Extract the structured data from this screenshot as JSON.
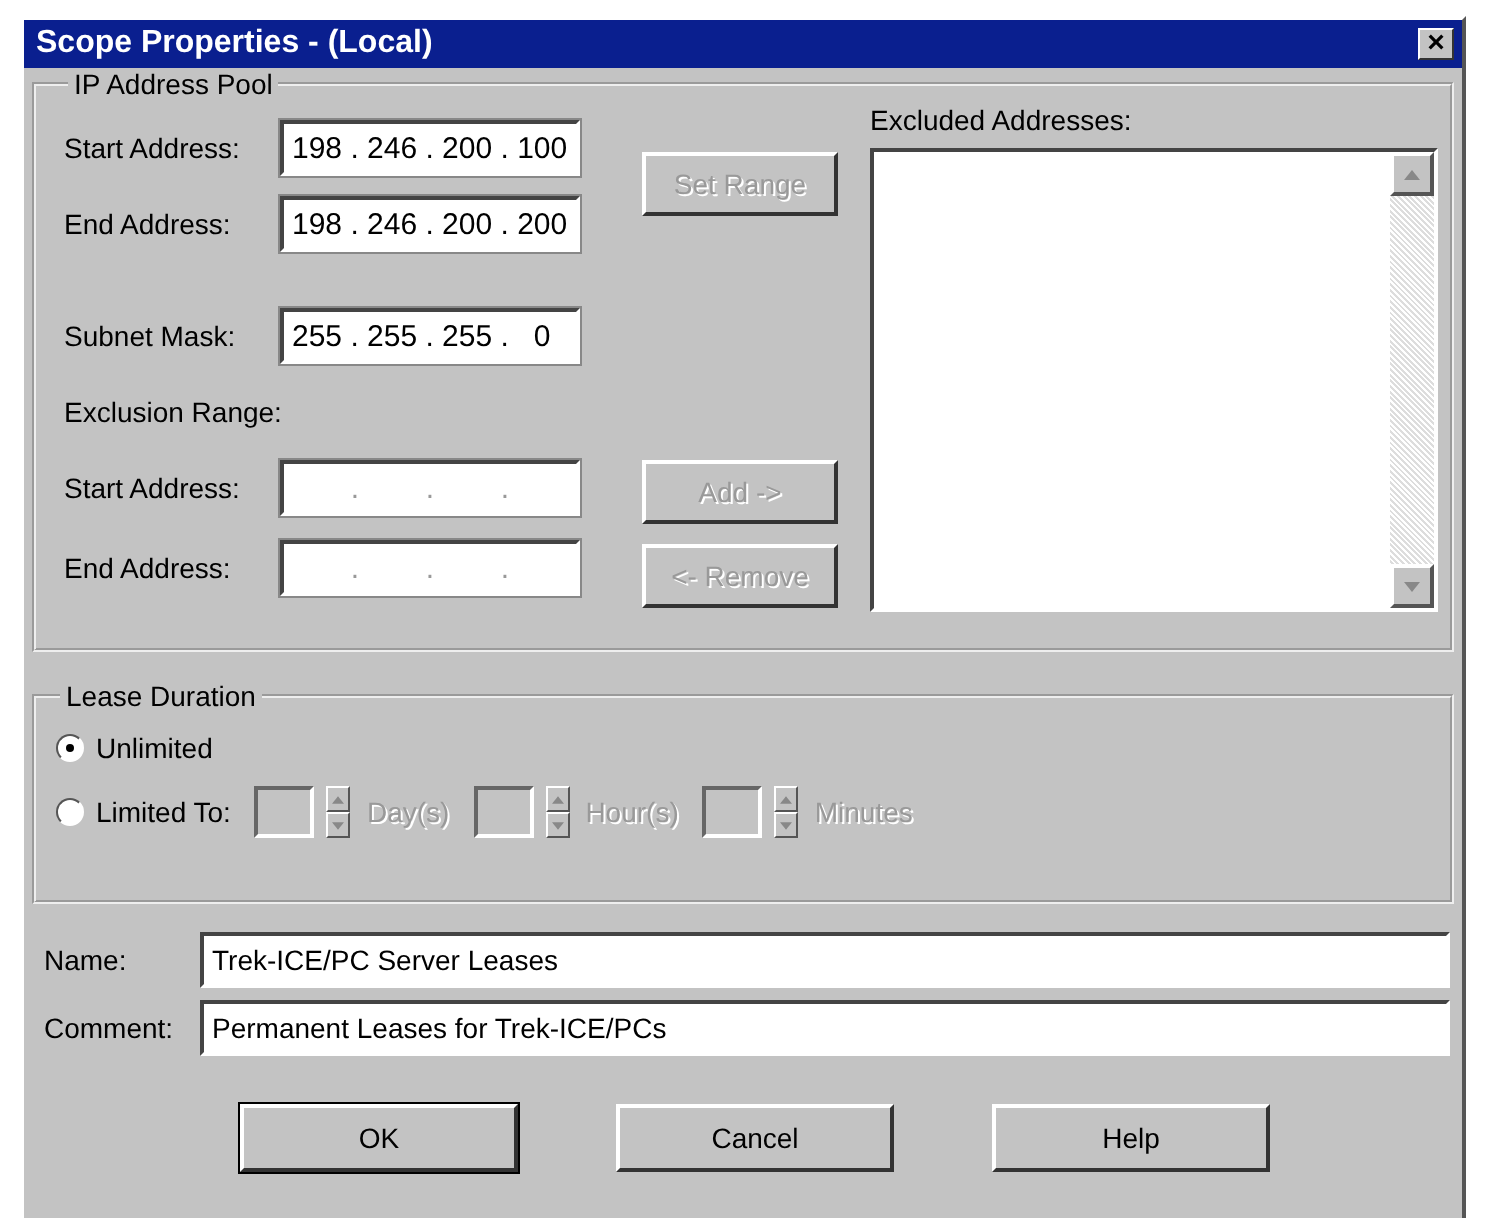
{
  "window": {
    "title": "Scope Properties - (Local)",
    "close": "×"
  },
  "ip_pool": {
    "title": "IP Address Pool",
    "start_address": {
      "label": "Start Address:",
      "value": "198 . 246 . 200 . 100"
    },
    "end_address": {
      "label": "End Address:",
      "value": "198 . 246 . 200 . 200"
    },
    "set_range": {
      "label": "Set Range",
      "disabled": true
    },
    "subnet_mask": {
      "label": "Subnet Mask:",
      "value": "255 . 255 . 255 .   0"
    },
    "exclusion_range": {
      "label": "Exclusion Range:",
      "start_address": {
        "label": "Start Address:",
        "value": ".        .        ."
      },
      "end_address": {
        "label": "End Address:",
        "value": ".        .        ."
      }
    },
    "add": {
      "label": "Add ->",
      "disabled": true
    },
    "remove": {
      "label": "<- Remove",
      "disabled": true
    },
    "excluded_addresses": {
      "label": "Excluded Addresses:"
    }
  },
  "lease_duration": {
    "title": "Lease Duration",
    "options": [
      {
        "label": "Unlimited",
        "selected": true
      },
      {
        "label": "Limited To:",
        "selected": false
      }
    ],
    "spinners": [
      {
        "unit": "Day(s)",
        "disabled": true
      },
      {
        "unit": "Hour(s)",
        "disabled": true
      },
      {
        "unit": "Minutes",
        "disabled": true
      }
    ]
  },
  "name": {
    "label": "Name:",
    "value": "Trek-ICE/PC Server Leases"
  },
  "comment": {
    "label": "Comment:",
    "value": "Permanent Leases for Trek-ICE/PCs"
  },
  "buttons": [
    {
      "label": "OK",
      "default": true
    },
    {
      "label": "Cancel",
      "default": false
    },
    {
      "label": "Help",
      "default": false
    }
  ]
}
